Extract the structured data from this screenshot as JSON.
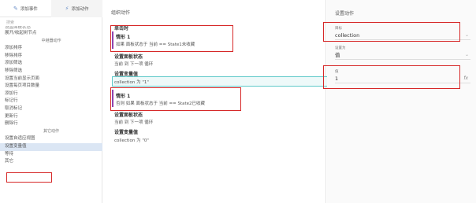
{
  "tabs": [
    {
      "icon": "✎",
      "label": "添加事件"
    },
    {
      "icon": "⚡",
      "label": "添加动作"
    }
  ],
  "search_placeholder": "搜索",
  "left_list": [
    {
      "label": "设置面板状态",
      "type": "cut"
    },
    {
      "label": "展开/收起树节点",
      "type": "item"
    },
    {
      "label": "中继器动作",
      "type": "header"
    },
    {
      "label": "添加排序",
      "type": "item"
    },
    {
      "label": "移除排序",
      "type": "item"
    },
    {
      "label": "添加筛选",
      "type": "item"
    },
    {
      "label": "移除筛选",
      "type": "item"
    },
    {
      "label": "设置当前显示页面",
      "type": "item"
    },
    {
      "label": "设置每页项目数量",
      "type": "item"
    },
    {
      "label": "添加行",
      "type": "item"
    },
    {
      "label": "标记行",
      "type": "item"
    },
    {
      "label": "取消标记",
      "type": "item"
    },
    {
      "label": "更新行",
      "type": "item"
    },
    {
      "label": "删除行",
      "type": "item"
    },
    {
      "label": "其它动作",
      "type": "header"
    },
    {
      "label": "设置自适应视图",
      "type": "item"
    },
    {
      "label": "设置变量值",
      "type": "selected"
    },
    {
      "label": "等待",
      "type": "item"
    },
    {
      "label": "其它",
      "type": "item"
    }
  ],
  "middle": {
    "title": "组织动作",
    "event": "单击时",
    "case1": {
      "name": "情形 1",
      "if_kw": "如果",
      "condition": "面板状态于 当前 == State1未收藏"
    },
    "set_panel_1": "设置面板状态",
    "set_panel_1_detail": "当前 到 下一项 循环",
    "set_var_1": "设置变量值",
    "set_var_1_detail": "collection 为 \"1\"",
    "case2": {
      "name": "情形 1",
      "if_kw": "否则 如果",
      "condition": "面板状态于 当前 == State2已收藏"
    },
    "set_panel_2": "设置面板状态",
    "set_panel_2_detail": "当前 到 下一项 循环",
    "set_var_2": "设置变量值",
    "set_var_2_detail": "collection 为 \"0\""
  },
  "right": {
    "title": "设置动作",
    "target_label": "目标",
    "target_value": "collection",
    "setto_label": "设置为",
    "setto_value": "值",
    "value_label": "值",
    "value_value": "1",
    "fx": "fx"
  },
  "colors": {
    "highlight_border": "#d62828",
    "case_bar": "#8e44ad",
    "selected_row": "#5fc9c9"
  }
}
